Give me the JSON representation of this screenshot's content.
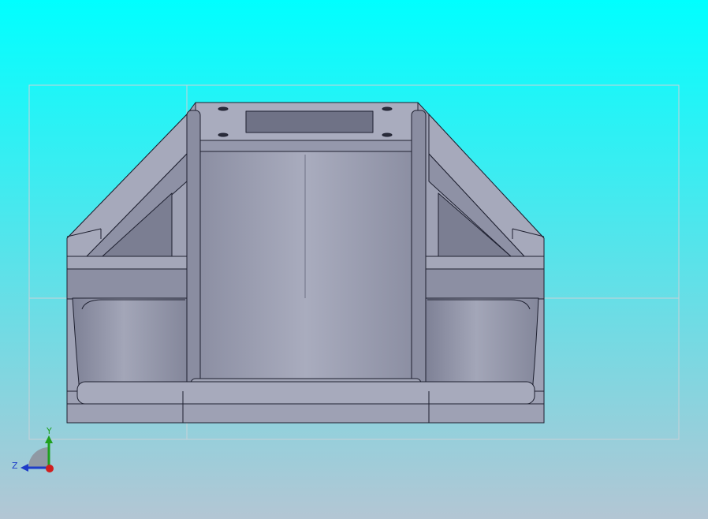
{
  "viewport": {
    "background_top": "#00FFFF",
    "background_bottom": "#B3C6D4"
  },
  "model": {
    "face_color": "#9EA1B4",
    "face_dark": "#7B7E92",
    "face_light": "#AEB1C2",
    "edge_color": "#1E2030"
  },
  "triad": {
    "y_label": "Y",
    "z_label": "Z",
    "y_color": "#1EA01E",
    "z_color": "#1E3CC8",
    "x_color": "#D01E1E"
  }
}
